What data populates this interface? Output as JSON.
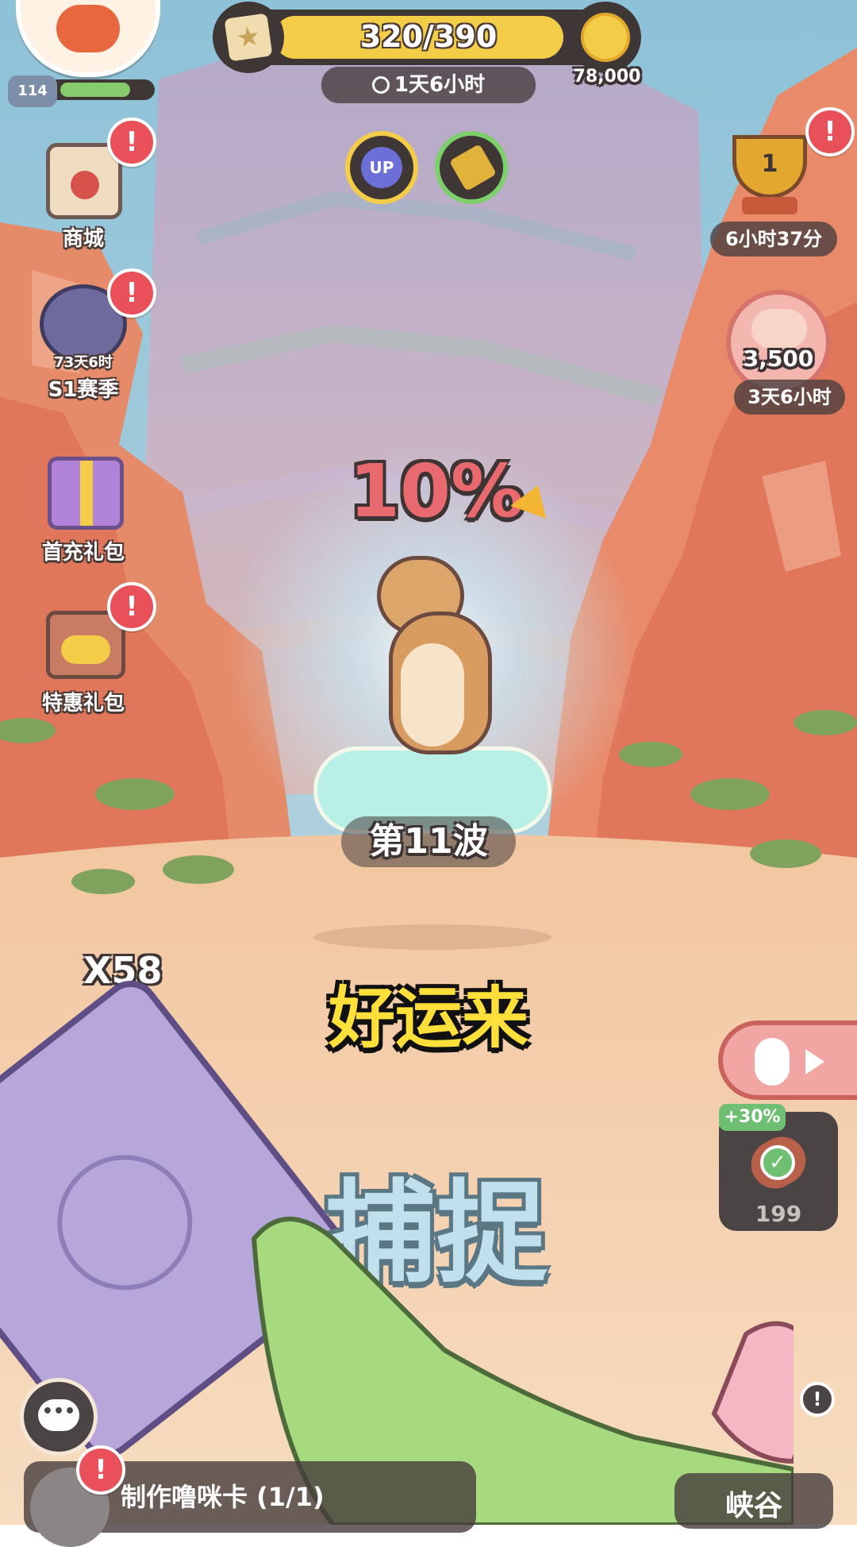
{
  "player": {
    "level": "114",
    "level_progress": 0.8
  },
  "top_bar": {
    "progress_text": "320/390",
    "progress_fraction": 0.82,
    "timer": "1天6小时",
    "coins": "78,000"
  },
  "boost_buttons": [
    {
      "name": "up-boost",
      "label": "UP"
    },
    {
      "name": "hammer-boost",
      "label": ""
    }
  ],
  "left_menu": [
    {
      "name": "shop",
      "label": "商城",
      "sub": ""
    },
    {
      "name": "season",
      "label": "S1赛季",
      "sub": "73天6时"
    },
    {
      "name": "first-recharge",
      "label": "首充礼包",
      "sub": ""
    },
    {
      "name": "special-pack",
      "label": "特惠礼包",
      "sub": ""
    }
  ],
  "right_menu": {
    "trophy_rank": "1",
    "trophy_timer": "6小时37分",
    "event_points": "3,500",
    "event_timer": "3天6小时"
  },
  "badge_text": "!",
  "capture": {
    "chance": "10%",
    "wave": "第11波",
    "banner": "好运来",
    "action": "捕捉",
    "card_count": "X58"
  },
  "bait": {
    "bonus": "+30%",
    "count": "199"
  },
  "bottom": {
    "task": "制作噜咪卡 (1/1)",
    "location": "峡谷"
  },
  "colors": {
    "sky": "#8fc5d6",
    "rock": "#e98a6a",
    "sand": "#f5d3b0",
    "gold": "#f3cc48",
    "badge": "#e9505a",
    "card": "#b6a6d9"
  }
}
